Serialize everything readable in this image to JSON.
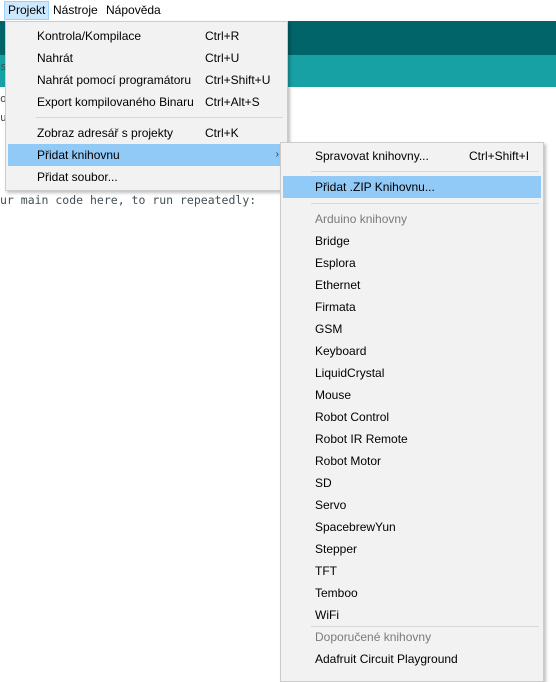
{
  "menubar": {
    "items": [
      {
        "label": "Projekt"
      },
      {
        "label": "Nástroje"
      },
      {
        "label": "Nápověda"
      }
    ]
  },
  "editor": {
    "code_line": "ur main code here, to run repeatedly:",
    "stray_chars": [
      "s",
      "o",
      "u"
    ]
  },
  "project_menu": {
    "items": [
      {
        "label": "Kontrola/Kompilace",
        "shortcut": "Ctrl+R"
      },
      {
        "label": "Nahrát",
        "shortcut": "Ctrl+U"
      },
      {
        "label": "Nahrát pomocí programátoru",
        "shortcut": "Ctrl+Shift+U"
      },
      {
        "label": "Export kompilovaného Binaru",
        "shortcut": "Ctrl+Alt+S"
      },
      {
        "label": "Zobraz adresář s projekty",
        "shortcut": "Ctrl+K"
      },
      {
        "label": "Přidat knihovnu",
        "shortcut": ""
      },
      {
        "label": "Přidat soubor...",
        "shortcut": ""
      }
    ]
  },
  "library_menu": {
    "manage": {
      "label": "Spravovat knihovny...",
      "shortcut": "Ctrl+Shift+I"
    },
    "add_zip": {
      "label": "Přidat .ZIP Knihovnu..."
    },
    "arduino_header": "Arduino knihovny",
    "arduino_libs": [
      "Bridge",
      "Esplora",
      "Ethernet",
      "Firmata",
      "GSM",
      "Keyboard",
      "LiquidCrystal",
      "Mouse",
      "Robot Control",
      "Robot IR Remote",
      "Robot Motor",
      "SD",
      "Servo",
      "SpacebrewYun",
      "Stepper",
      "TFT",
      "Temboo",
      "WiFi"
    ],
    "recommended_header": "Doporučené knihovny",
    "recommended_libs": [
      "Adafruit Circuit Playground"
    ]
  },
  "colors": {
    "toolbar_dark": "#006468",
    "toolbar_light": "#17a1a5",
    "menu_highlight": "#91c9f7",
    "menubar_active": "#cce8ff"
  },
  "icons": {
    "submenu": "chevron-right-icon"
  }
}
